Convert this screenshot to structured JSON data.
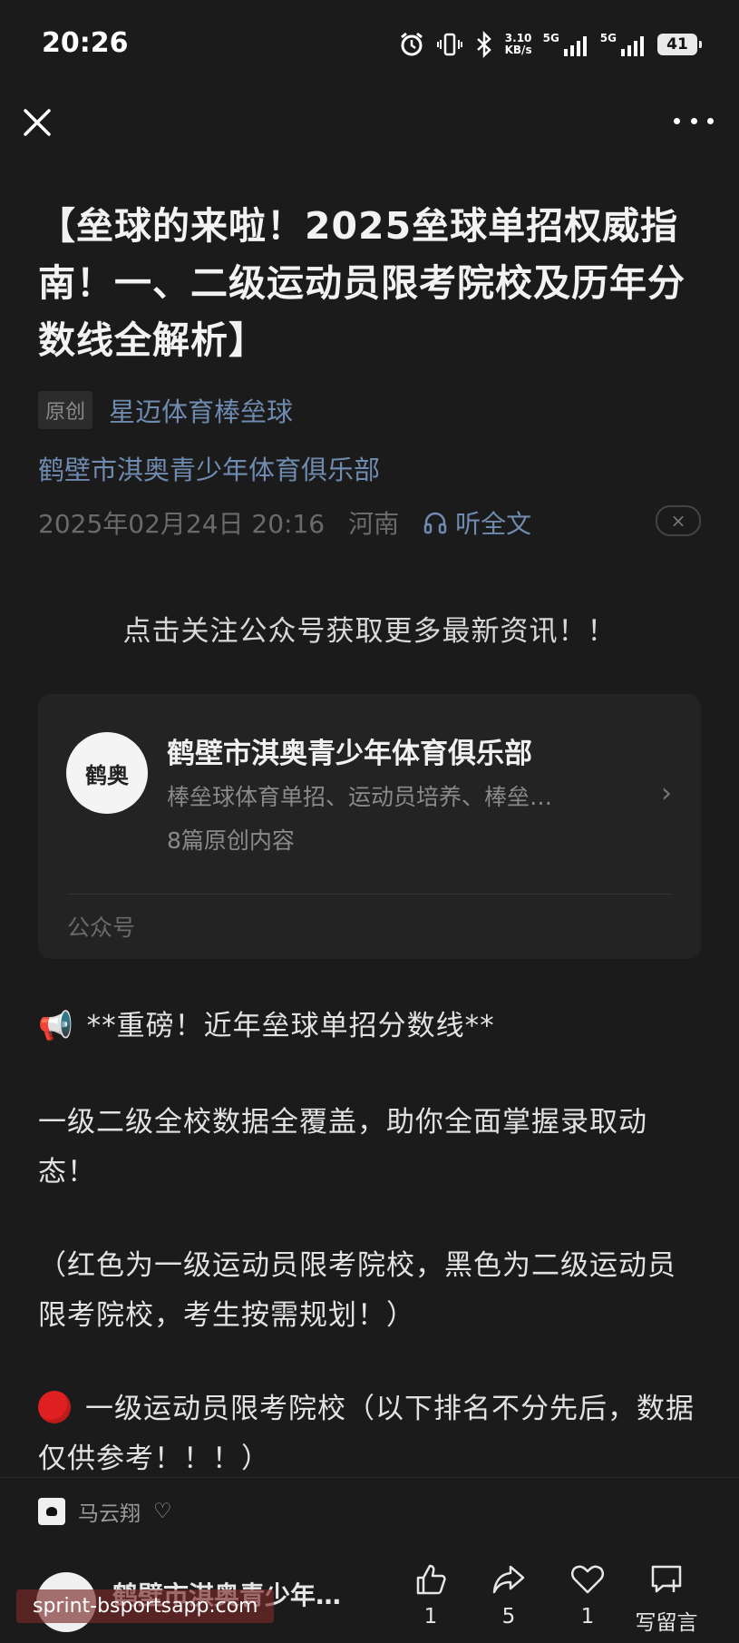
{
  "status_bar": {
    "time": "20:26",
    "net_speed_value": "3.10",
    "net_speed_unit": "KB/s",
    "sim1_label": "5G",
    "sim2_label": "5G",
    "battery": "41"
  },
  "nav": {
    "close_icon": "close-icon",
    "more_icon": "more-icon"
  },
  "article": {
    "title": "【垒球的来啦！2025垒球单招权威指南！一、二级运动员限考院校及历年分数线全解析】",
    "original_tag": "原创",
    "author": "星迈体育棒垒球",
    "club": "鹤壁市淇奥青少年体育俱乐部",
    "date": "2025年02月24日 20:16",
    "location": "河南",
    "listen_label": "听全文",
    "dismiss_label": "×",
    "follow_prompt": "点击关注公众号获取更多最新资讯！！"
  },
  "account_card": {
    "avatar_text": "鹤奥",
    "name": "鹤壁市淇奥青少年体育俱乐部",
    "description": "棒垒球体育单招、运动员培养、棒垒…",
    "count": "8篇原创内容",
    "chevron": "›",
    "footer": "公众号"
  },
  "body": {
    "megaphone_icon": "📢",
    "line1": "**重磅！近年垒球单招分数线**",
    "line2": "一级二级全校数据全覆盖，助你全面掌握录取动态！",
    "line3": "（红色为一级运动员限考院校，黑色为二级运动员限考院校，考生按需规划！）",
    "line4": "一级运动员限考院校（以下排名不分先后，数据仅供参考！！！）"
  },
  "bottom_bar": {
    "reader_name": "马云翔",
    "reader_heart": "♡",
    "account_name": "鹤壁市淇奥青少年…",
    "like_count": "1",
    "share_count": "5",
    "fav_count": "1",
    "comment_label": "写留言"
  },
  "watermark": "sprint-bsportsapp.com"
}
